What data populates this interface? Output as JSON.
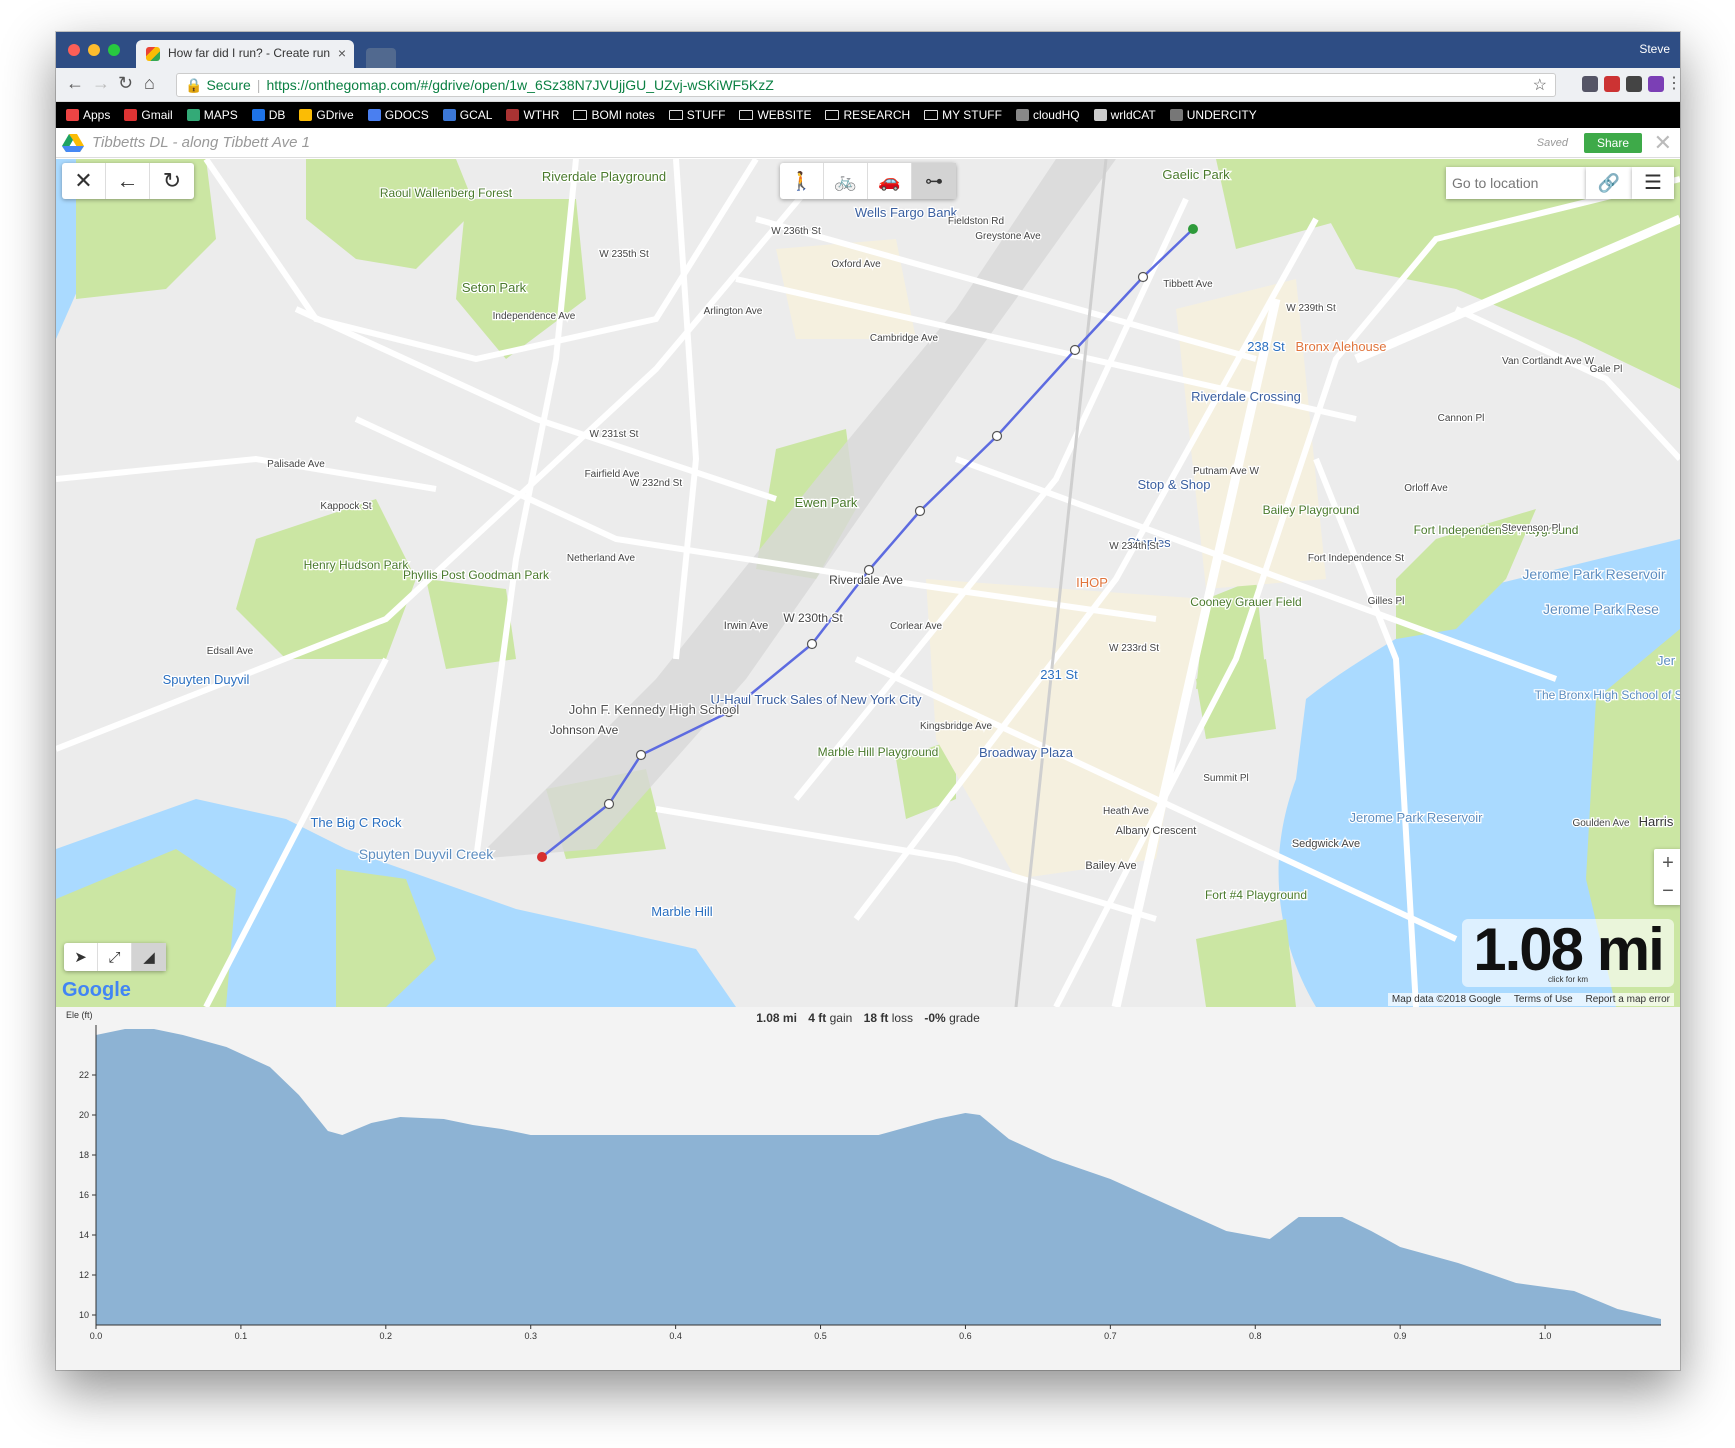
{
  "browser": {
    "tab_title": "How far did I run? - Create run",
    "tab_close": "×",
    "profile": "Steve",
    "secure_label": "Secure",
    "url": "https://onthegomap.com/#/gdrive/open/1w_6Sz38N7JVUjjGU_UZvj-wSKiWF5KzZ",
    "bookmarks": [
      "Apps",
      "Gmail",
      "MAPS",
      "DB",
      "GDrive",
      "GDOCS",
      "GCAL",
      "WTHR",
      "BOMI notes",
      "STUFF",
      "WEBSITE",
      "RESEARCH",
      "MY STUFF",
      "cloudHQ",
      "wrldCAT",
      "UNDERCITY"
    ],
    "bookmark_icon_colors": [
      "#e44",
      "#d33",
      "#3a7",
      "#1e73e8",
      "#fbbc05",
      "#4a7ff0",
      "#3c78d8",
      "#a33",
      "#ddd",
      "#ddd",
      "#ddd",
      "#ddd",
      "#ddd",
      "#888",
      "#ccc",
      "#777"
    ]
  },
  "app": {
    "doc_title": "Tibbetts DL - along Tibbett Ave 1",
    "saved": "Saved",
    "share": "Share",
    "close": "✕"
  },
  "map": {
    "left_controls": [
      "close-icon",
      "undo-icon",
      "reverse-icon"
    ],
    "left_glyphs": [
      "✕",
      "←",
      "↻"
    ],
    "mode_controls": [
      "walk-icon",
      "bike-icon",
      "car-icon",
      "straight-line-icon"
    ],
    "mode_glyphs": [
      "🚶",
      "🚲",
      "🚗",
      "⊶"
    ],
    "active_mode": "straight-line-icon",
    "search_placeholder": "Go to location",
    "zoom_in": "+",
    "zoom_out": "−",
    "distance": "1.08 mi",
    "distance_sub": "click for km",
    "google": "Google",
    "attribution": [
      "Map data ©2018 Google",
      "Terms of Use",
      "Report a map error"
    ],
    "route_color": "#5d6be0",
    "start_color": "#2e9a3a",
    "end_color": "#d62f2f",
    "labels": [
      "Riverdale Playground",
      "Raoul Wallenberg Forest",
      "Seton Park",
      "Wells Fargo Bank",
      "Gaelic Park",
      "Bronx Alehouse",
      "238 St",
      "Riverdale Crossing",
      "Ewen Park",
      "Stop & Shop",
      "Staples",
      "Bailey Playground",
      "Fort Independence Playground",
      "Jerome Park Reservoir",
      "IHOP",
      "Cooney Grauer Field",
      "231 St",
      "U-Haul Truck Sales of New York City",
      "John F. Kennedy High School",
      "Marble Hill Playground",
      "Broadway Plaza",
      "Henry Hudson Park",
      "Phyllis Post Goodman Park",
      "Spuyten Duyvil",
      "The Big C Rock",
      "Spuyten Duyvil Creek",
      "Marble Hill",
      "Fort #4 Playground",
      "The Bronx High School of Science",
      "Harris",
      "Jerome Park Reservoir",
      "Johnson Ave",
      "W 230th St",
      "Riverdale Ave",
      "Irwin Ave",
      "Tibbett Ave",
      "Corlear Ave",
      "Kingsbridge Ave",
      "Bailey Ave",
      "Sedgwick Ave",
      "Van Cortlandt Ave W",
      "W 236th St",
      "W 235th St",
      "W 232nd St",
      "W 231st St",
      "Independence Ave",
      "Palisade Ave",
      "Kappock St",
      "Netherland Ave",
      "Fieldston Rd",
      "Greystone Ave",
      "Oxford Ave",
      "Cambridge Ave",
      "Arlington Ave",
      "Fairfield Ave",
      "Edsall Ave",
      "W 239th St",
      "Cannon Pl",
      "Orloff Ave",
      "Gale Pl",
      "Summit Pl",
      "Albany Crescent",
      "Heath Ave",
      "Goulden Ave",
      "W 233rd St",
      "W 234th St",
      "Putnam Ave W",
      "Fort Independence St",
      "Gilles Pl",
      "Stevenson Pl",
      "Jerome Park Rese",
      "Jer"
    ]
  },
  "elevation": {
    "distance": "1.08 mi",
    "gain_value": "4 ft",
    "gain_label": "gain",
    "loss_value": "18 ft",
    "loss_label": "loss",
    "grade_value": "-0%",
    "grade_label": "grade",
    "y_label": "Ele (ft)",
    "fill_color": "#8db3d4"
  },
  "chart_data": {
    "type": "area",
    "title": "",
    "xlabel": "",
    "ylabel": "Ele (ft)",
    "xlim": [
      0,
      1.08
    ],
    "ylim": [
      9.5,
      24.5
    ],
    "x_ticks": [
      "0.0",
      "0.1",
      "0.2",
      "0.3",
      "0.4",
      "0.5",
      "0.6",
      "0.7",
      "0.8",
      "0.9",
      "1.0"
    ],
    "y_ticks": [
      "10",
      "12",
      "14",
      "16",
      "18",
      "20",
      "22"
    ],
    "x": [
      0.0,
      0.02,
      0.04,
      0.06,
      0.09,
      0.12,
      0.14,
      0.16,
      0.17,
      0.19,
      0.21,
      0.24,
      0.26,
      0.28,
      0.3,
      0.34,
      0.4,
      0.45,
      0.5,
      0.54,
      0.56,
      0.58,
      0.6,
      0.61,
      0.63,
      0.66,
      0.7,
      0.74,
      0.78,
      0.81,
      0.83,
      0.86,
      0.88,
      0.9,
      0.94,
      0.98,
      1.0,
      1.02,
      1.05,
      1.08
    ],
    "y": [
      24.0,
      24.3,
      24.3,
      24.0,
      23.4,
      22.4,
      21.0,
      19.2,
      19.0,
      19.6,
      19.9,
      19.8,
      19.5,
      19.3,
      19.0,
      19.0,
      19.0,
      19.0,
      19.0,
      19.0,
      19.4,
      19.8,
      20.1,
      20.0,
      18.8,
      17.8,
      16.8,
      15.5,
      14.2,
      13.8,
      14.9,
      14.9,
      14.2,
      13.4,
      12.6,
      11.6,
      11.4,
      11.2,
      10.3,
      9.8
    ]
  }
}
